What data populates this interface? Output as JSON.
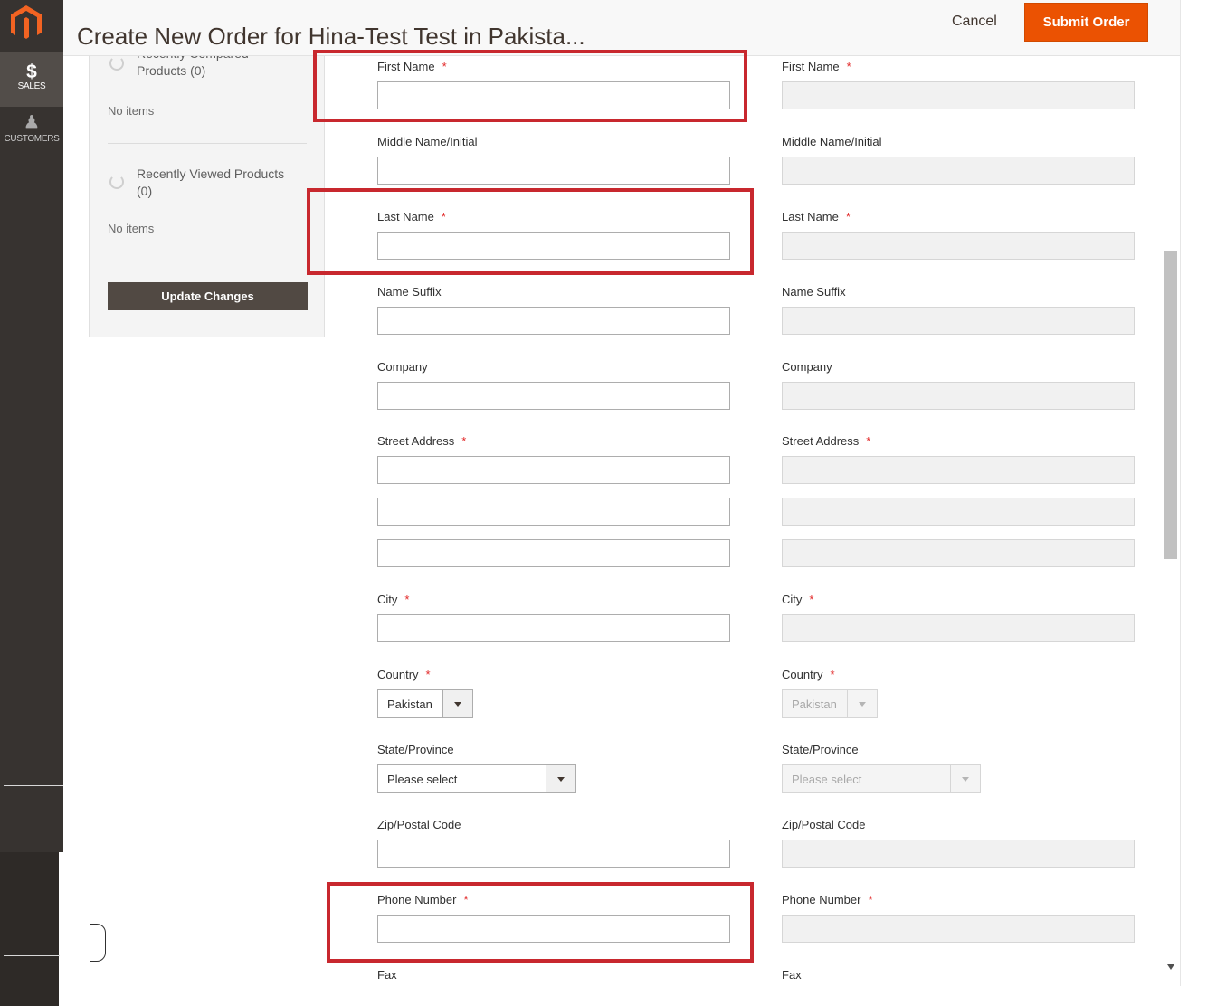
{
  "header": {
    "title": "Create New Order for Hina-Test Test in Pakista...",
    "cancel_label": "Cancel",
    "submit_label": "Submit Order"
  },
  "nav": {
    "logo_icon": "magento-logo-icon",
    "items": [
      {
        "label": "SALES",
        "glyph": "$",
        "icon": "dollar-icon"
      },
      {
        "label": "CUSTOMERS",
        "glyph": "♟",
        "icon": "person-icon"
      }
    ]
  },
  "sidebar": {
    "compared_title": "Recently Compared Products (0)",
    "compared_empty": "No items",
    "viewed_title": "Recently Viewed Products (0)",
    "viewed_empty": "No items",
    "update_label": "Update Changes"
  },
  "form": {
    "required_mark": "*",
    "labels": {
      "first_name": "First Name",
      "middle_name": "Middle Name/Initial",
      "last_name": "Last Name",
      "suffix": "Name Suffix",
      "company": "Company",
      "street": "Street Address",
      "city": "City",
      "country": "Country",
      "state": "State/Province",
      "zip": "Zip/Postal Code",
      "phone": "Phone Number",
      "fax": "Fax"
    },
    "country_value": "Pakistan",
    "state_placeholder": "Please select"
  },
  "colors": {
    "accent": "#eb5202",
    "highlight": "#c8282e",
    "nav_bg": "#373330"
  }
}
